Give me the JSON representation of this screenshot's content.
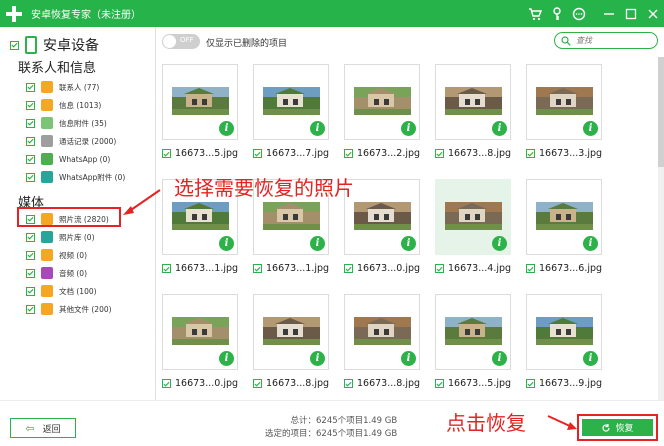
{
  "app": {
    "title": "安卓恢复专家（未注册）"
  },
  "titlebar_icons": [
    "cart-icon",
    "key-icon",
    "chat-icon",
    "minimize-icon",
    "close-icon"
  ],
  "sidebar": {
    "device_title": "安卓设备",
    "section_contacts": "联系人和信息",
    "contacts_items": [
      {
        "label": "联系人 (77)",
        "icon": "contacts-icon",
        "color": "#f5a623"
      },
      {
        "label": "信息 (1013)",
        "icon": "message-icon",
        "color": "#f5a623"
      },
      {
        "label": "信息附件 (35)",
        "icon": "attachment-icon",
        "color": "#7cc576"
      },
      {
        "label": "通话记录 (2000)",
        "icon": "phone-call-icon",
        "color": "#9e9e9e"
      },
      {
        "label": "WhatsApp (0)",
        "icon": "whatsapp-icon",
        "color": "#4caf50"
      },
      {
        "label": "WhatsApp附件 (0)",
        "icon": "whatsapp-attachment-icon",
        "color": "#26a69a"
      }
    ],
    "section_media": "媒体",
    "media_items": [
      {
        "label": "照片流 (2820)",
        "icon": "photo-stream-icon",
        "color": "#f5a623"
      },
      {
        "label": "照片库 (0)",
        "icon": "photo-library-icon",
        "color": "#26a69a"
      },
      {
        "label": "视频 (0)",
        "icon": "video-icon",
        "color": "#f5a623"
      },
      {
        "label": "音频 (0)",
        "icon": "audio-icon",
        "color": "#ab47bc"
      },
      {
        "label": "文档 (100)",
        "icon": "document-icon",
        "color": "#f5a623"
      },
      {
        "label": "其他文件 (200)",
        "icon": "other-files-icon",
        "color": "#f5a623"
      }
    ]
  },
  "toolbar": {
    "toggle_text": "OFF",
    "toggle_label": "仅显示已删除的项目",
    "search_placeholder": "查找"
  },
  "files": [
    "16673...5.jpg",
    "16673...7.jpg",
    "16673...2.jpg",
    "16673...8.jpg",
    "16673...3.jpg",
    "16673...1.jpg",
    "16673...1.jpg",
    "16673...0.jpg",
    "16673...4.jpg",
    "16673...6.jpg",
    "16673...0.jpg",
    "16673...8.jpg",
    "16673...8.jpg",
    "16673...5.jpg",
    "16673...9.jpg"
  ],
  "footer": {
    "back_label": "返回",
    "total_label": "总计：6245个项目1.49 GB",
    "selected_label": "选定的项目：6245个项目1.49 GB",
    "recover_label": "恢复"
  },
  "annotations": {
    "select_hint": "选择需要恢复的照片",
    "click_hint": "点击恢复"
  },
  "colors": {
    "accent": "#2db24a",
    "titlebar": "#26b34a",
    "annotation": "#e62222"
  }
}
